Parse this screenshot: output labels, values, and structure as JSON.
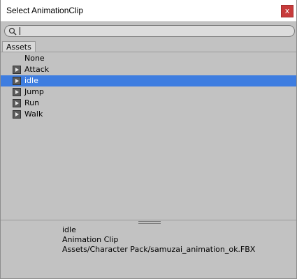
{
  "window": {
    "title": "Select AnimationClip",
    "close_label": "x"
  },
  "search": {
    "value": "",
    "placeholder": ""
  },
  "tabs": [
    {
      "label": "Assets"
    }
  ],
  "items": [
    {
      "label": "None",
      "icon": null,
      "selected": false
    },
    {
      "label": "Attack",
      "icon": "animation-clip-icon",
      "selected": false
    },
    {
      "label": "idle",
      "icon": "animation-clip-icon",
      "selected": true
    },
    {
      "label": "Jump",
      "icon": "animation-clip-icon",
      "selected": false
    },
    {
      "label": "Run",
      "icon": "animation-clip-icon",
      "selected": false
    },
    {
      "label": "Walk",
      "icon": "animation-clip-icon",
      "selected": false
    }
  ],
  "info": {
    "name": "idle",
    "type": "Animation Clip",
    "path": "Assets/Character Pack/samuzai_animation_ok.FBX"
  },
  "colors": {
    "background": "#c2c2c2",
    "selection": "#3e7de0",
    "close_button": "#c73b3b"
  }
}
